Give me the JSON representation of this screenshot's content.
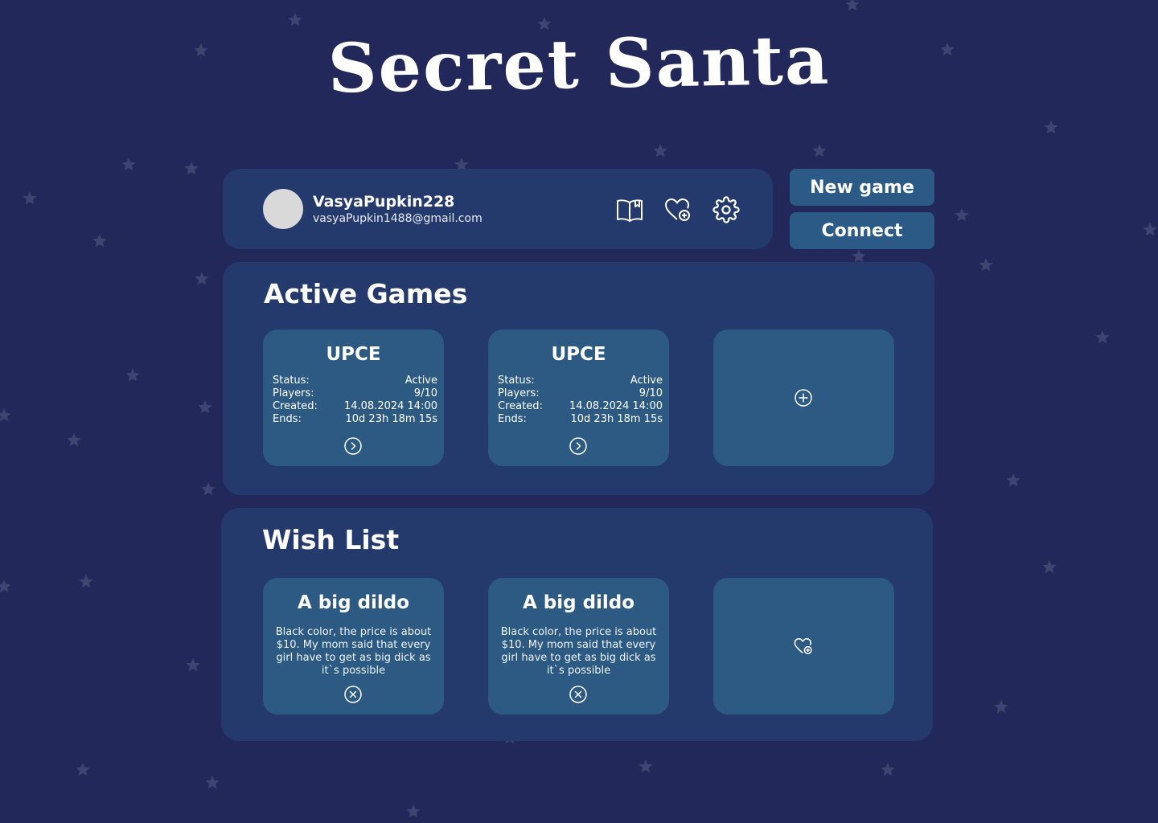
{
  "app": {
    "title": "Secret Santa"
  },
  "profile": {
    "username": "VasyaPupkin228",
    "email": "vasyaPupkin1488@gmail.com",
    "icons": [
      "book-icon",
      "heart-add-icon",
      "gear-icon"
    ]
  },
  "actions": {
    "new_game": "New game",
    "connect": "Connect"
  },
  "games": {
    "title": "Active Games",
    "labels": {
      "status": "Status:",
      "players": "Players:",
      "created": "Created:",
      "ends": "Ends:"
    },
    "items": [
      {
        "name": "UPCE",
        "status": "Active",
        "players": "9/10",
        "created": "14.08.2024 14:00",
        "ends": "10d 23h 18m 15s"
      },
      {
        "name": "UPCE",
        "status": "Active",
        "players": "9/10",
        "created": "14.08.2024 14:00",
        "ends": "10d 23h 18m 15s"
      }
    ]
  },
  "wishlist": {
    "title": "Wish List",
    "items": [
      {
        "title": "A big dildo",
        "description": "Black color, the price is about $10. My mom said that every girl have to get as big dick as it`s possible"
      },
      {
        "title": "A big dildo",
        "description": "Black color, the price is about $10. My mom said that every girl have to get as big dick as it`s possible"
      }
    ]
  },
  "colors": {
    "background": "#22295a",
    "panel": "#253a6c",
    "card": "#2c5a82",
    "button": "#2c5a86",
    "star": "#3d4670",
    "text": "#ffffff"
  }
}
